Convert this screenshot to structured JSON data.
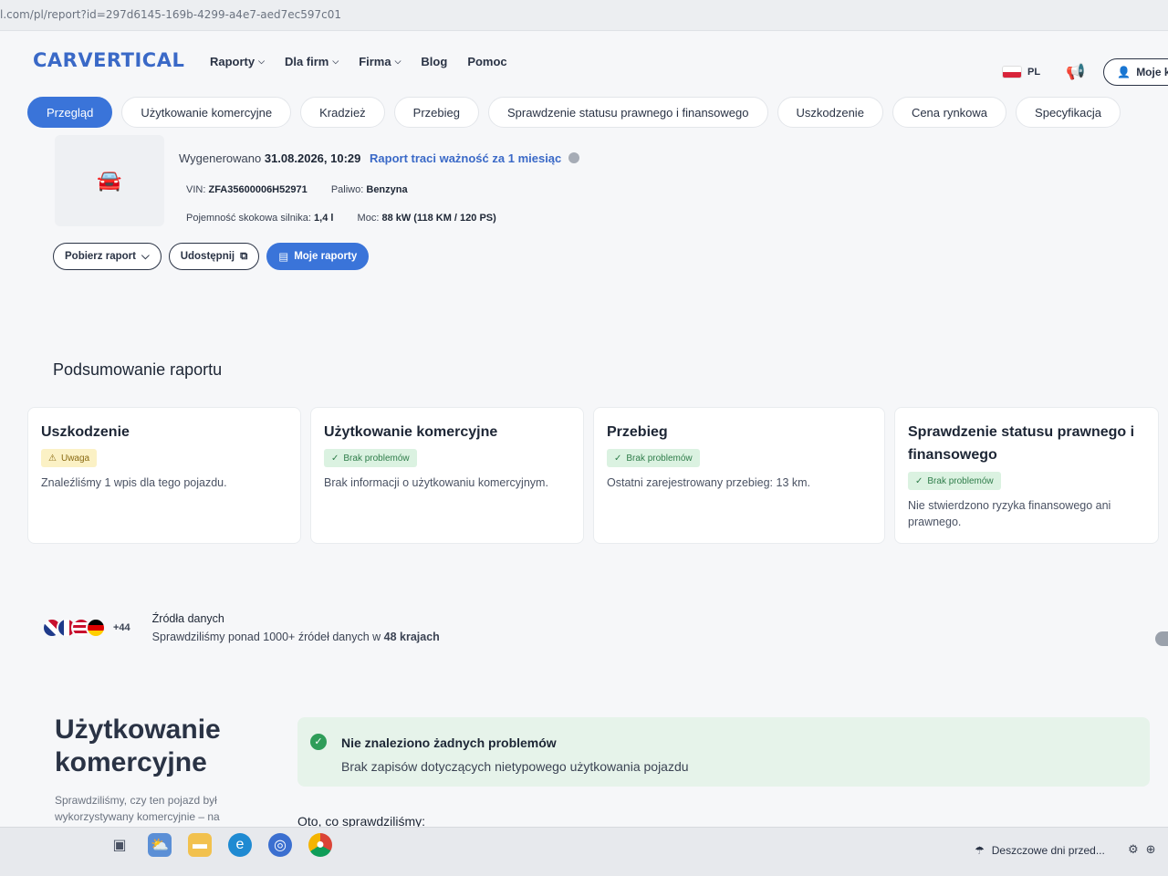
{
  "browser": {
    "url": "l.com/pl/report?id=297d6145-169b-4299-a4e7-aed7ec597c01"
  },
  "header": {
    "logo": "CARVERTICAL",
    "nav": [
      {
        "label": "Raporty",
        "dropdown": true
      },
      {
        "label": "Dla firm",
        "dropdown": true
      },
      {
        "label": "Firma",
        "dropdown": true
      },
      {
        "label": "Blog",
        "dropdown": false
      },
      {
        "label": "Pomoc",
        "dropdown": false
      }
    ],
    "language": "PL",
    "account_label": "Moje ko"
  },
  "tabs": [
    {
      "label": "Przegląd",
      "active": true
    },
    {
      "label": "Użytkowanie komercyjne",
      "active": false
    },
    {
      "label": "Kradzież",
      "active": false
    },
    {
      "label": "Przebieg",
      "active": false
    },
    {
      "label": "Sprawdzenie statusu prawnego i finansowego",
      "active": false
    },
    {
      "label": "Uszkodzenie",
      "active": false
    },
    {
      "label": "Cena rynkowa",
      "active": false
    },
    {
      "label": "Specyfikacja",
      "active": false
    }
  ],
  "report": {
    "generated_label": "Wygenerowano",
    "generated_at": "31.08.2026, 10:29",
    "expiry": "Raport traci ważność za 1 miesiąc",
    "vin_label": "VIN:",
    "vin": "ZFA35600006H52971",
    "fuel_label": "Paliwo:",
    "fuel": "Benzyna",
    "engine_label": "Pojemność skokowa silnika:",
    "engine": "1,4 l",
    "power_label": "Moc:",
    "power": "88 kW (118 KM / 120 PS)"
  },
  "actions": {
    "download": "Pobierz raport",
    "share": "Udostępnij",
    "my_reports": "Moje raporty"
  },
  "summary": {
    "title": "Podsumowanie raportu",
    "cards": [
      {
        "title": "Uszkodzenie",
        "status": "Uwaga",
        "status_type": "warn",
        "text": "Znaleźliśmy 1 wpis dla tego pojazdu."
      },
      {
        "title": "Użytkowanie komercyjne",
        "status": "Brak problemów",
        "status_type": "ok",
        "text": "Brak informacji o użytkowaniu komercyjnym."
      },
      {
        "title": "Przebieg",
        "status": "Brak problemów",
        "status_type": "ok",
        "text": "Ostatni zarejestrowany przebieg: 13 km."
      },
      {
        "title": "Sprawdzenie statusu prawnego i finansowego",
        "status": "Brak problemów",
        "status_type": "ok",
        "text": "Nie stwierdzono ryzyka finansowego ani prawnego."
      }
    ]
  },
  "sources": {
    "count_more": "+44",
    "title": "Źródła danych",
    "text_prefix": "Sprawdziliśmy ponad 1000+ źródeł danych w",
    "text_bold": "48 krajach"
  },
  "commercial_use": {
    "title": "Użytkowanie komercyjne",
    "subtitle": "Sprawdziliśmy, czy ten pojazd był wykorzystywany komercyjnie – na",
    "ok_title": "Nie znaleziono żadnych problemów",
    "ok_text": "Brak zapisów dotyczących nietypowego użytkowania pojazdu",
    "checked_title": "Oto, co sprawdziliśmy:"
  },
  "taskbar": {
    "weather": "Deszczowe dni przed...",
    "colors": {
      "accent": "#3a74d9",
      "ok": "#2f9d59",
      "warn": "#f5d34f"
    }
  }
}
